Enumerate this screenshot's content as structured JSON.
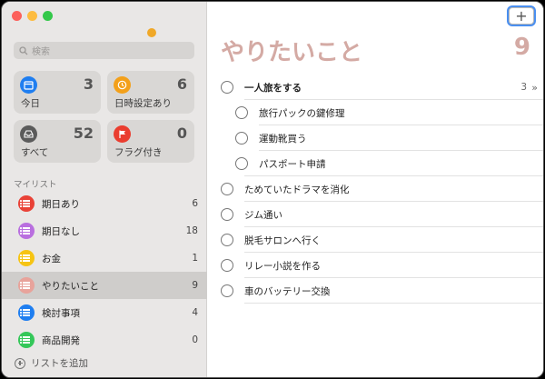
{
  "search": {
    "placeholder": "検索"
  },
  "smart_lists": [
    {
      "label": "今日",
      "count": "3",
      "color": "#1f7ef0",
      "icon": "calendar-icon"
    },
    {
      "label": "日時設定あり",
      "count": "6",
      "color": "#f3a01a",
      "icon": "clock-icon"
    },
    {
      "label": "すべて",
      "count": "52",
      "color": "#5b5b5b",
      "icon": "tray-icon"
    },
    {
      "label": "フラグ付き",
      "count": "0",
      "color": "#ea3d2f",
      "icon": "flag-icon"
    }
  ],
  "my_lists_title": "マイリスト",
  "lists": [
    {
      "name": "期日あり",
      "count": "6",
      "color": "#e94237"
    },
    {
      "name": "期日なし",
      "count": "18",
      "color": "#b96fdf"
    },
    {
      "name": "お金",
      "count": "1",
      "color": "#f6c413"
    },
    {
      "name": "やりたいこと",
      "count": "9",
      "color": "#e8a39b",
      "selected": true
    },
    {
      "name": "検討事項",
      "count": "4",
      "color": "#1f7ef0"
    },
    {
      "name": "商品開発",
      "count": "0",
      "color": "#34c759"
    }
  ],
  "add_list_label": "リストを追加",
  "main": {
    "add_button": "+",
    "title": "やりたいこと",
    "count": "9",
    "title_color": "#d4aaa4"
  },
  "tasks": [
    {
      "text": "一人旅をする",
      "level": 0,
      "parent": true,
      "subcount": "3",
      "chevron": "»"
    },
    {
      "text": "旅行パックの鍵修理",
      "level": 1
    },
    {
      "text": "運動靴買う",
      "level": 1
    },
    {
      "text": "パスポート申請",
      "level": 1
    },
    {
      "text": "ためていたドラマを消化",
      "level": 0
    },
    {
      "text": "ジム通い",
      "level": 0
    },
    {
      "text": "脱毛サロンへ行く",
      "level": 0
    },
    {
      "text": "リレー小説を作る",
      "level": 0
    },
    {
      "text": "車のバッテリー交換",
      "level": 0
    }
  ]
}
